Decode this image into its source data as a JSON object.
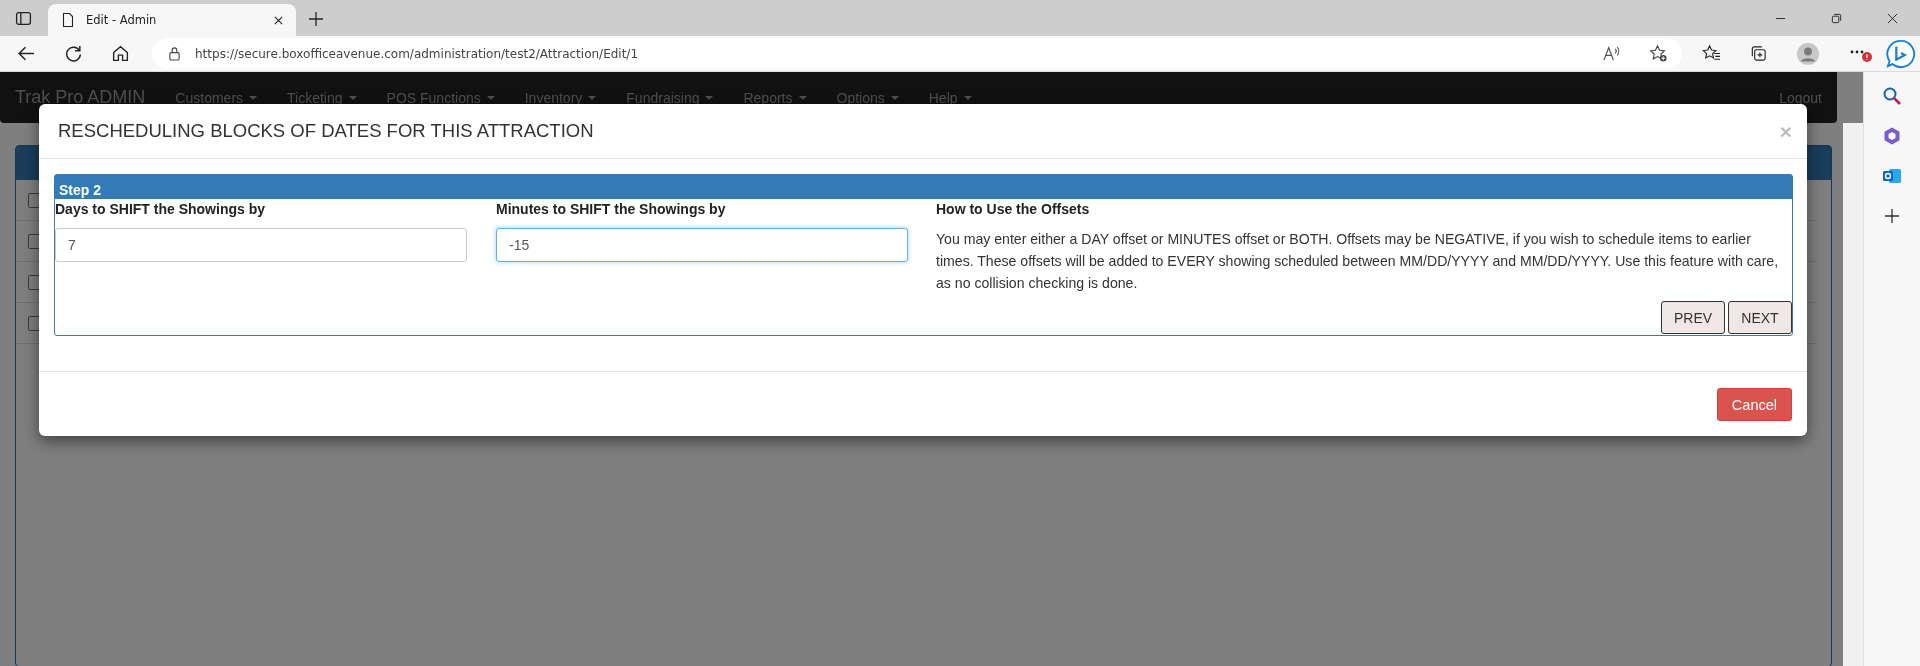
{
  "browser": {
    "tab_title": "Edit - Admin",
    "url": "https://secure.boxofficeavenue.com/administration/test2/Attraction/Edit/1"
  },
  "navbar": {
    "brand": "Trak Pro ADMIN",
    "items": [
      {
        "label": "Customers",
        "dropdown": true
      },
      {
        "label": "Ticketing",
        "dropdown": true
      },
      {
        "label": "POS Functions",
        "dropdown": true
      },
      {
        "label": "Inventory",
        "dropdown": true
      },
      {
        "label": "Fundraising",
        "dropdown": true
      },
      {
        "label": "Reports",
        "dropdown": true
      },
      {
        "label": "Options",
        "dropdown": true
      },
      {
        "label": "Help",
        "dropdown": true
      }
    ],
    "logout": "Logout"
  },
  "background_rows": [
    {
      "checked": false
    },
    {
      "checked": false
    },
    {
      "checked": false
    },
    {
      "checked": false
    }
  ],
  "modal": {
    "title": "RESCHEDULING BLOCKS OF DATES FOR THIS ATTRACTION",
    "close": "×",
    "step": {
      "title": "Step 2",
      "fields": [
        {
          "label": "Days to SHIFT the Showings by",
          "value": "7",
          "focused": false
        },
        {
          "label": "Minutes to SHIFT the Showings by",
          "value": "-15",
          "focused": true
        }
      ],
      "help": {
        "title": "How to Use the Offsets",
        "text": "You may enter either a DAY offset or MINUTES offset or BOTH. Offsets may be NEGATIVE, if you wish to schedule items to earlier times. These offsets will be added to EVERY showing scheduled between MM/DD/YYYY and MM/DD/YYYY. Use this feature with care, as no collision checking is done."
      },
      "buttons": [
        "PREV",
        "NEXT"
      ]
    },
    "footer_buttons": [
      {
        "label": "Cancel",
        "kind": "danger"
      }
    ]
  }
}
